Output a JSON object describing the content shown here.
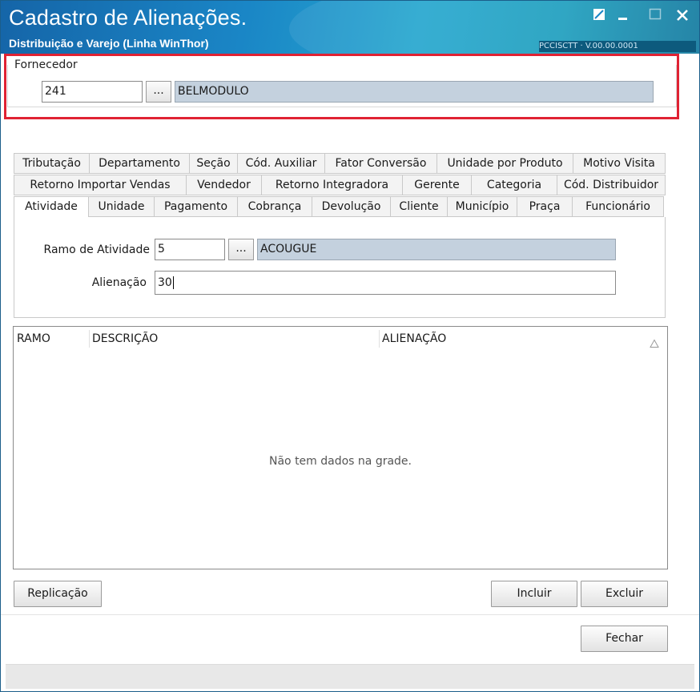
{
  "window": {
    "title": "Cadastro de Alienações.",
    "subtitle": "Distribuição e Varejo (Linha WinThor)",
    "strip_text": "PCCISCTT · V.00.00.0001"
  },
  "fornecedor": {
    "legend": "Fornecedor",
    "code": "241",
    "lookup_label": "...",
    "name": "BELMODULO"
  },
  "tabs": {
    "row1": [
      "Tributação",
      "Departamento",
      "Seção",
      "Cód. Auxiliar",
      "Fator Conversão",
      "Unidade por Produto",
      "Motivo Visita"
    ],
    "row2": [
      "Retorno Importar Vendas",
      "Vendedor",
      "Retorno Integradora",
      "Gerente",
      "Categoria",
      "Cód. Distribuidor"
    ],
    "row3": [
      "Atividade",
      "Unidade",
      "Pagamento",
      "Cobrança",
      "Devolução",
      "Cliente",
      "Município",
      "Praça",
      "Funcionário"
    ],
    "active": "Atividade"
  },
  "atividade": {
    "ramo_label": "Ramo de Atividade",
    "ramo_code": "5",
    "lookup_label": "...",
    "ramo_desc": "ACOUGUE",
    "alienacao_label": "Alienação",
    "alienacao_value": "30"
  },
  "grid": {
    "columns": [
      "RAMO",
      "DESCRIÇÃO",
      "ALIENAÇÃO"
    ],
    "sort_icon": "sort-triangle-icon",
    "empty_text": "Não tem dados na grade."
  },
  "buttons": {
    "replicacao": "Replicação",
    "incluir": "Incluir",
    "excluir": "Excluir",
    "fechar": "Fechar"
  }
}
